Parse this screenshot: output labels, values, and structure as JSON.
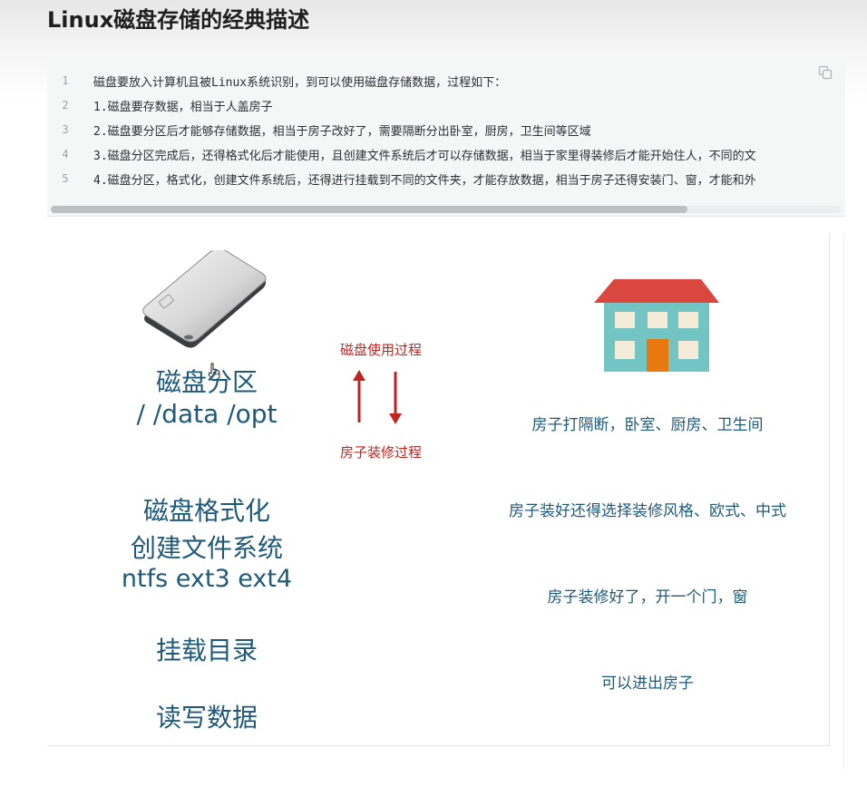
{
  "page": {
    "title": "Linux磁盘存储的经典描述"
  },
  "code": {
    "lines": [
      {
        "no": "1",
        "text": "磁盘要放入计算机且被Linux系统识别，到可以使用磁盘存储数据，过程如下："
      },
      {
        "no": "2",
        "text": "1.磁盘要存数据，相当于人盖房子"
      },
      {
        "no": "3",
        "text": "2.磁盘要分区后才能够存储数据，相当于房子改好了，需要隔断分出卧室，厨房，卫生间等区域"
      },
      {
        "no": "4",
        "text": "3.磁盘分区完成后，还得格式化后才能使用，且创建文件系统后才可以存储数据，相当于家里得装修后才能开始住人，不同的文"
      },
      {
        "no": "5",
        "text": "4.磁盘分区，格式化，创建文件系统后，还得进行挂载到不同的文件夹，才能存放数据，相当于房子还得安装门、窗，才能和外"
      }
    ],
    "copy_icon": "copy-icon"
  },
  "slide": {
    "left": {
      "partition_title": "磁盘分区",
      "partition_paths": "/  /data /opt",
      "format_title": "磁盘格式化",
      "create_fs": "创建文件系统",
      "fs_types": "ntfs  ext3 ext4",
      "mount": "挂载目录",
      "read_write": "读写数据"
    },
    "middle": {
      "top_label": "磁盘使用过程",
      "bottom_label": "房子装修过程"
    },
    "right": {
      "partition_analogy": "房子打隔断，卧室、厨房、卫生间",
      "style_analogy": "房子装好还得选择装修风格、欧式、中式",
      "door_analogy": "房子装修好了，开一个门，窗",
      "enter_analogy": "可以进出房子"
    },
    "images": {
      "disk": "external-hard-drive-icon",
      "house": "house-icon",
      "cursor": "hand-cursor-icon"
    },
    "colors": {
      "text_blue": "#1e5a78",
      "text_red": "#c0241f",
      "roof_red": "#d9473f",
      "wall_teal": "#72c5c2",
      "door_orange": "#e8790f"
    }
  }
}
